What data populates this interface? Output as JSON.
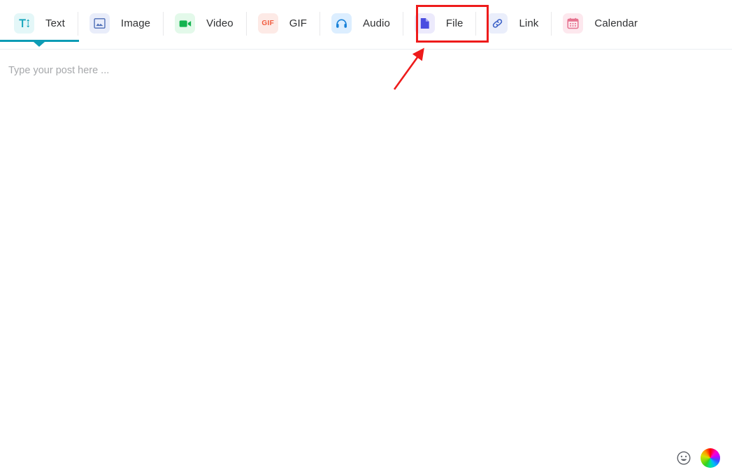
{
  "toolbar": {
    "tabs": [
      {
        "label": "Text",
        "icon": "text-format-icon",
        "active": true
      },
      {
        "label": "Image",
        "icon": "image-icon",
        "active": false
      },
      {
        "label": "Video",
        "icon": "video-camera-icon",
        "active": false
      },
      {
        "label": "GIF",
        "icon": "gif-icon",
        "active": false
      },
      {
        "label": "Audio",
        "icon": "headphones-icon",
        "active": false
      },
      {
        "label": "File",
        "icon": "file-document-icon",
        "active": false
      },
      {
        "label": "Link",
        "icon": "chain-link-icon",
        "active": false
      },
      {
        "label": "Calendar",
        "icon": "calendar-icon",
        "active": false
      }
    ],
    "gif_icon_text": "GIF",
    "active_tab_color": "#0d9cb5"
  },
  "editor": {
    "placeholder": "Type your post here ...",
    "value": ""
  },
  "bottom_controls": {
    "emoji_icon": "smiley-face-icon",
    "color_picker_icon": "color-wheel-icon"
  },
  "annotation": {
    "highlight_target": "File",
    "color": "#ee1b1b"
  }
}
